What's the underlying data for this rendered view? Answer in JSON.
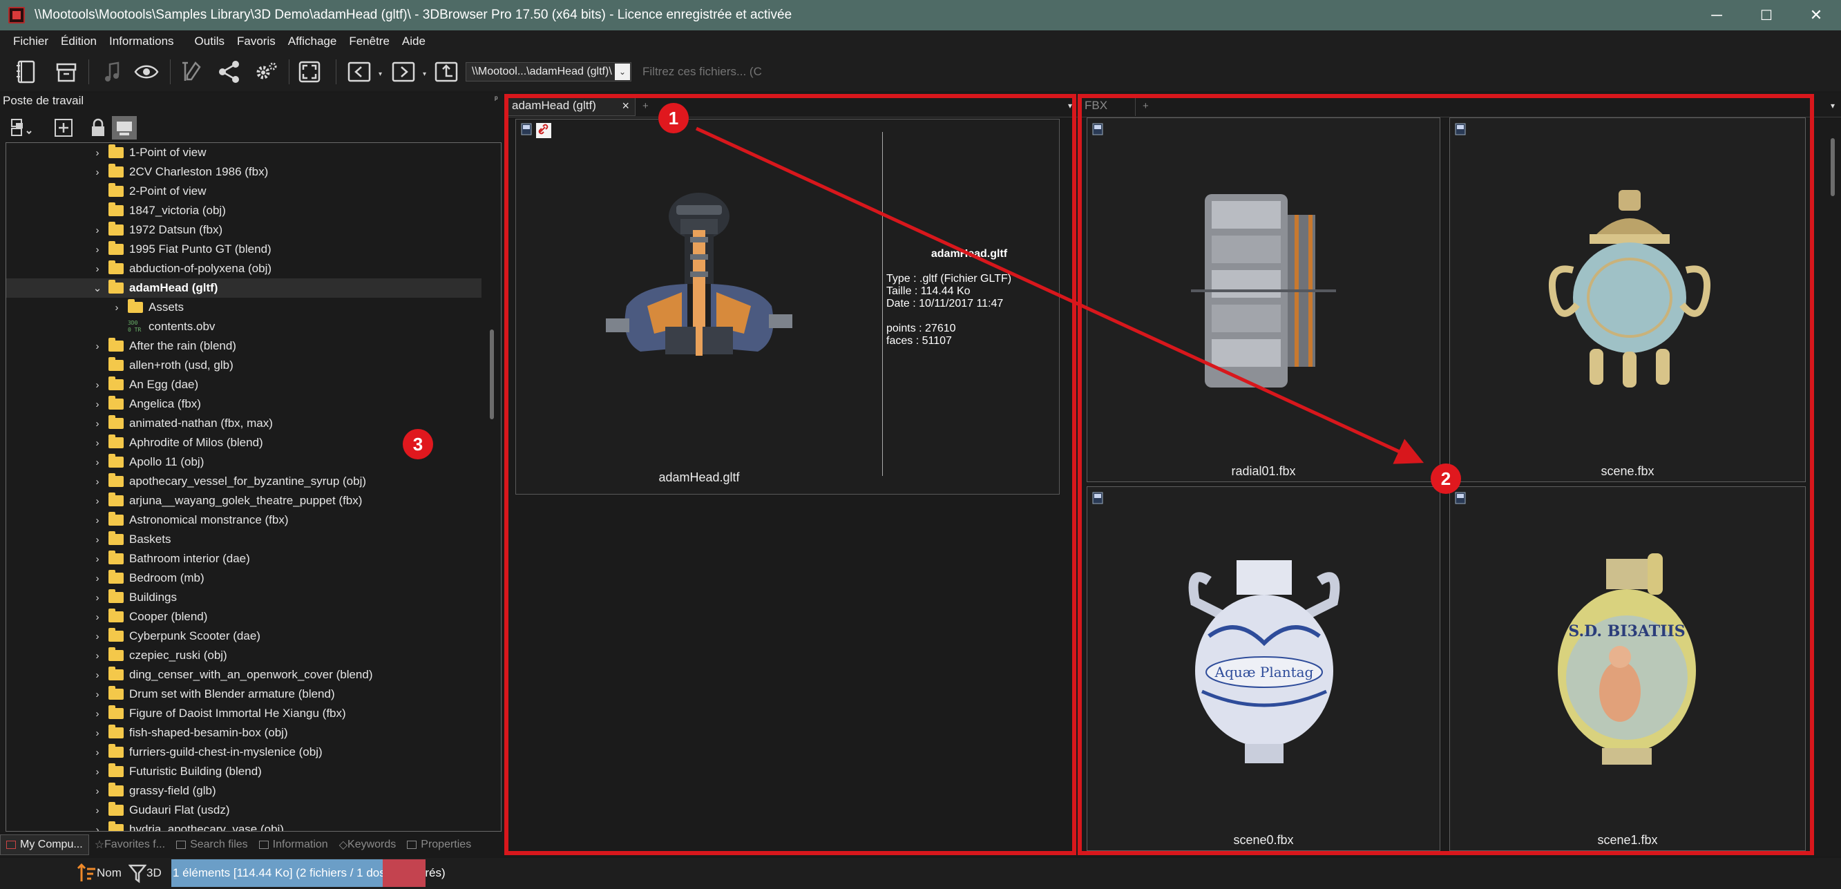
{
  "window": {
    "title": "\\\\Mootools\\Mootools\\Samples Library\\3D Demo\\adamHead (gltf)\\ - 3DBrowser Pro 17.50 (x64 bits) - Licence enregistrée  et activée",
    "minimize": "─",
    "maximize": "☐",
    "close": "✕"
  },
  "menu": [
    "Fichier",
    "Édition",
    "Informations",
    "Outils",
    "Favoris",
    "Affichage",
    "Fenêtre",
    "Aide"
  ],
  "toolbar": {
    "path": "\\\\Mootool...\\adamHead (gltf)\\",
    "path_dropdown": "⌄",
    "filter_placeholder": "Filtrez ces fichiers... (C"
  },
  "left_panel": {
    "title": "Poste de travail",
    "pin": "ᵖ",
    "tree": [
      {
        "label": "1-Point of view",
        "expandable": true,
        "indent": 0
      },
      {
        "label": "2CV Charleston 1986 (fbx)",
        "expandable": true,
        "indent": 0
      },
      {
        "label": "2-Point of view",
        "expandable": false,
        "indent": 0
      },
      {
        "label": "1847_victoria (obj)",
        "expandable": false,
        "indent": 0
      },
      {
        "label": "1972 Datsun (fbx)",
        "expandable": true,
        "indent": 0
      },
      {
        "label": "1995 Fiat Punto GT (blend)",
        "expandable": true,
        "indent": 0
      },
      {
        "label": "abduction-of-polyxena (obj)",
        "expandable": true,
        "indent": 0
      },
      {
        "label": "adamHead (gltf)",
        "expandable": true,
        "expanded": true,
        "selected": true,
        "indent": 0
      },
      {
        "label": "Assets",
        "expandable": true,
        "indent": 1
      },
      {
        "label": "contents.obv",
        "expandable": false,
        "indent": 1,
        "file": true,
        "file_icon_text": "3D0\n0 TR"
      },
      {
        "label": "After the rain (blend)",
        "expandable": true,
        "indent": 0
      },
      {
        "label": "allen+roth (usd, glb)",
        "expandable": false,
        "indent": 0
      },
      {
        "label": "An Egg (dae)",
        "expandable": true,
        "indent": 0
      },
      {
        "label": "Angelica (fbx)",
        "expandable": true,
        "indent": 0
      },
      {
        "label": "animated-nathan (fbx, max)",
        "expandable": true,
        "indent": 0
      },
      {
        "label": "Aphrodite of Milos (blend)",
        "expandable": true,
        "indent": 0
      },
      {
        "label": "Apollo 11 (obj)",
        "expandable": true,
        "indent": 0
      },
      {
        "label": "apothecary_vessel_for_byzantine_syrup (obj)",
        "expandable": true,
        "indent": 0
      },
      {
        "label": "arjuna__wayang_golek_theatre_puppet (fbx)",
        "expandable": true,
        "indent": 0
      },
      {
        "label": "Astronomical monstrance (fbx)",
        "expandable": true,
        "indent": 0
      },
      {
        "label": "Baskets",
        "expandable": true,
        "indent": 0
      },
      {
        "label": "Bathroom interior (dae)",
        "expandable": true,
        "indent": 0
      },
      {
        "label": "Bedroom (mb)",
        "expandable": true,
        "indent": 0
      },
      {
        "label": "Buildings",
        "expandable": true,
        "indent": 0
      },
      {
        "label": "Cooper (blend)",
        "expandable": true,
        "indent": 0
      },
      {
        "label": "Cyberpunk Scooter (dae)",
        "expandable": true,
        "indent": 0
      },
      {
        "label": "czepiec_ruski (obj)",
        "expandable": true,
        "indent": 0
      },
      {
        "label": "ding_censer_with_an_openwork_cover (blend)",
        "expandable": true,
        "indent": 0
      },
      {
        "label": "Drum set with Blender armature (blend)",
        "expandable": true,
        "indent": 0
      },
      {
        "label": "Figure of Daoist Immortal He Xiangu (fbx)",
        "expandable": true,
        "indent": 0
      },
      {
        "label": "fish-shaped-besamin-box (obj)",
        "expandable": true,
        "indent": 0
      },
      {
        "label": "furriers-guild-chest-in-myslenice (obj)",
        "expandable": true,
        "indent": 0
      },
      {
        "label": "Futuristic Building (blend)",
        "expandable": true,
        "indent": 0
      },
      {
        "label": "grassy-field (glb)",
        "expandable": true,
        "indent": 0
      },
      {
        "label": "Gudauri Flat (usdz)",
        "expandable": true,
        "indent": 0
      },
      {
        "label": "hydria_apothecary_vase (obj)",
        "expandable": true,
        "indent": 0
      }
    ],
    "bottom_tabs": [
      "My Compu...",
      "Favorites f...",
      "Search files",
      "Information",
      "Keywords",
      "Properties"
    ]
  },
  "center_pane": {
    "tab_label": "adamHead (gltf)",
    "tab_close": "×",
    "tab_add": "+",
    "tab_menu": "▾",
    "file_name": "adamHead.gltf",
    "info": {
      "type": "Type : .gltf (Fichier GLTF)",
      "size": "Taille : 114.44 Ko",
      "date": "Date : 10/11/2017 11:47",
      "points": "points : 27610",
      "faces": "faces : 51107"
    },
    "caption": "adamHead.gltf"
  },
  "right_pane": {
    "tab_label": "FBX",
    "tab_add": "+",
    "tab_menu": "▾",
    "thumbnails": [
      "radial01.fbx",
      "scene.fbx",
      "scene0.fbx",
      "scene1.fbx"
    ],
    "vase_text_1": "Aquæ Plantag",
    "vase_text_2": "S.D. BI3ATIIS"
  },
  "statusbar": {
    "sort_label": "Nom",
    "filter_label": "3D",
    "info": "1 éléments [114.44 Ko] (2 fichiers / 1 dossiers filtrés)"
  },
  "annotations": [
    "1",
    "2",
    "3"
  ],
  "colors": {
    "titlebar": "#4f6b66",
    "annotation_red": "#d8171c",
    "status_blue": "#6b9ec7",
    "status_red": "#c4434f",
    "folder": "#f4c84a"
  }
}
